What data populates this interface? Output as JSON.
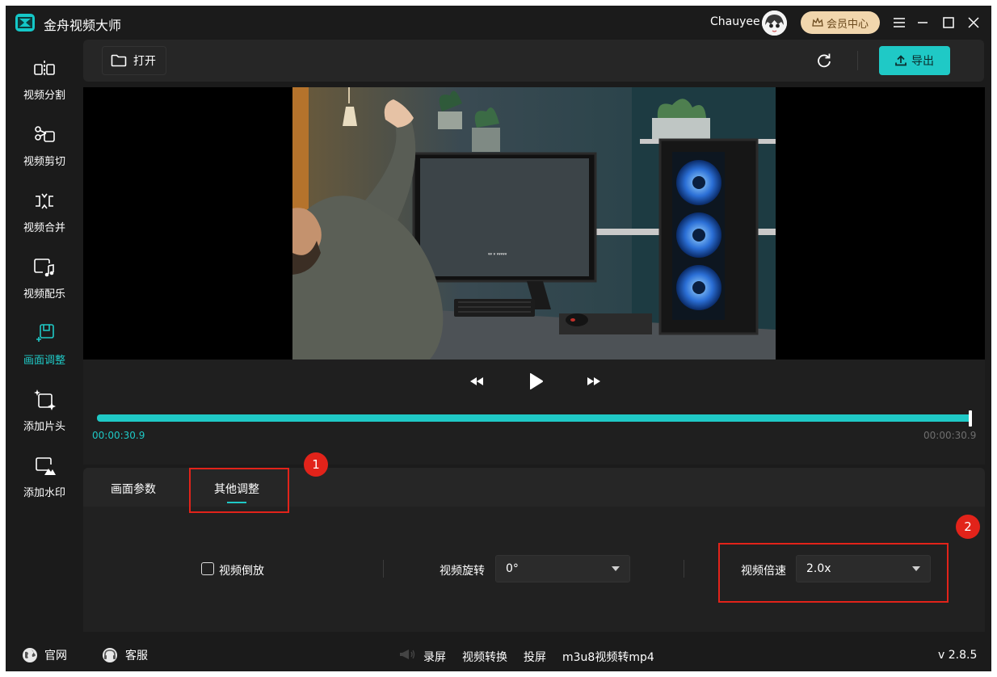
{
  "app": {
    "title": "金舟视频大师"
  },
  "user": {
    "name": "Chauyee",
    "vip_label": "会员中心"
  },
  "sidebar": {
    "items": [
      {
        "label": "视频分割",
        "icon": "split-icon"
      },
      {
        "label": "视频剪切",
        "icon": "scissors-icon"
      },
      {
        "label": "视频合并",
        "icon": "merge-icon"
      },
      {
        "label": "视频配乐",
        "icon": "music-icon"
      },
      {
        "label": "画面调整",
        "icon": "frame-adjust-icon",
        "active": true
      },
      {
        "label": "添加片头",
        "icon": "add-intro-icon"
      },
      {
        "label": "添加水印",
        "icon": "watermark-icon"
      }
    ]
  },
  "toolbar": {
    "open_label": "打开",
    "export_label": "导出"
  },
  "player": {
    "current_time": "00:00:30.9",
    "total_time": "00:00:30.9",
    "progress": 1.0
  },
  "tabs": [
    {
      "label": "画面参数",
      "active": false
    },
    {
      "label": "其他调整",
      "active": true
    }
  ],
  "settings": {
    "reverse_label": "视频倒放",
    "reverse_checked": false,
    "rotate_label": "视频旋转",
    "rotate_value": "0°",
    "speed_label": "视频倍速",
    "speed_value": "2.0x"
  },
  "annotations": {
    "badge1": "1",
    "badge2": "2"
  },
  "footer": {
    "website_label": "官网",
    "support_label": "客服",
    "links": [
      "录屏",
      "视频转换",
      "投屏",
      "m3u8视频转mp4"
    ],
    "version": "v 2.8.5"
  },
  "colors": {
    "accent": "#1fc9c6",
    "background": "#1b1b1b",
    "annotation": "#e2231a",
    "vip": "#f1d6ad"
  }
}
